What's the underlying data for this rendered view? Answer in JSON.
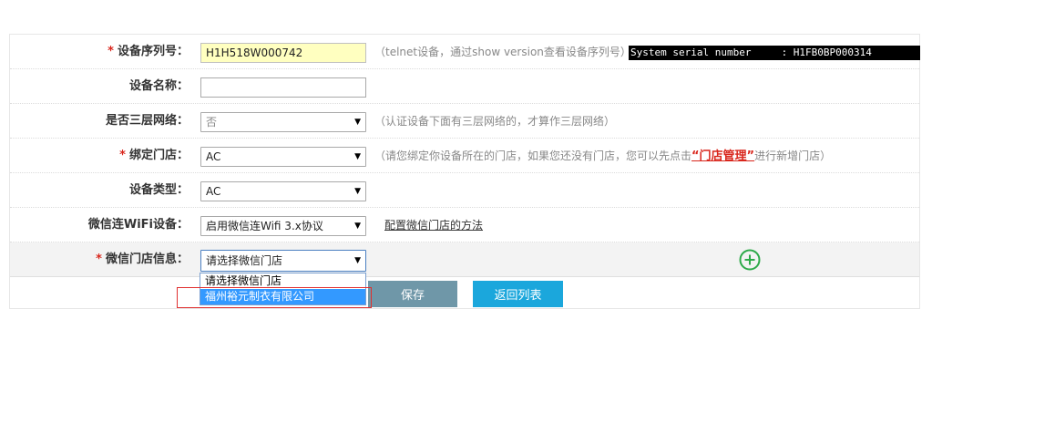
{
  "form": {
    "serial": {
      "required": "*",
      "label": "设备序列号：",
      "value": "H1H518W000742",
      "hint": "（telnet设备，通过show version查看设备序列号）",
      "terminal": "System serial number     : H1FB0BP000314"
    },
    "device_name": {
      "label": "设备名称：",
      "value": ""
    },
    "three_layer": {
      "label": "是否三层网络：",
      "value": "否",
      "hint": "（认证设备下面有三层网络的，才算作三层网络）"
    },
    "bind_store": {
      "required": "*",
      "label": "绑定门店：",
      "value": "AC",
      "hint_before": "（请您绑定你设备所在的门店，如果您还没有门店，您可以先点击",
      "hint_link": "“门店管理”",
      "hint_after": "进行新增门店）"
    },
    "device_type": {
      "label": "设备类型：",
      "value": "AC"
    },
    "wechat_wifi": {
      "label": "微信连WiFi设备：",
      "value": "启用微信连Wifi 3.x协议",
      "link": "配置微信门店的方法"
    },
    "wechat_store": {
      "required": "*",
      "label": "微信门店信息：",
      "value": "请选择微信门店",
      "options": [
        "请选择微信门店",
        "福州裕元制衣有限公司"
      ],
      "add_icon": "plus-circle-icon"
    }
  },
  "actions": {
    "save_label": "保存",
    "back_label": "返回列表"
  },
  "colors": {
    "required": "#d9261c",
    "save_button": "#6f97a8",
    "back_button": "#1ba7dc",
    "add_icon": "#2eaa4a",
    "option_highlight": "#3399ff"
  }
}
